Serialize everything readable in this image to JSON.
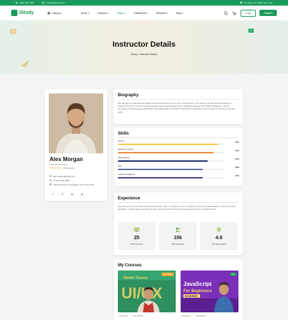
{
  "topbar": {
    "phone": "(000) 456 7890",
    "email": "contact@istudy.com",
    "address": "Brooklyn, NY 11201, New York"
  },
  "header": {
    "brand": "iStudy",
    "category": "Category",
    "nav": [
      {
        "label": "Home",
        "active": false
      },
      {
        "label": "Courses",
        "active": false
      },
      {
        "label": "Pages",
        "active": true
      },
      {
        "label": "Dashboard",
        "active": false
      },
      {
        "label": "Elements",
        "active": false
      },
      {
        "label": "Blog",
        "active": false
      }
    ],
    "login": "Login",
    "register": "Register"
  },
  "hero": {
    "title": "Instructor Details",
    "crumb_home": "iStudy",
    "crumb_sep": "›",
    "crumb_current": "Instructor Details"
  },
  "profile": {
    "name": "Alex Morgan",
    "title": "Data Science Expert",
    "stars": "★★★★★",
    "reviews": "(24 Reviews)",
    "email": "alex.morgan@istudy.com",
    "phone": "+1 (123) 456 7890",
    "address": "1123 Learning St, Knowledge City, KC 56 7153",
    "socials": [
      "f",
      "𝕏",
      "in",
      "◎"
    ]
  },
  "biography": {
    "title": "Biography",
    "text": "Alex Morgan is a Data Science Expert and an instructor with over 8 years of experience in the industry. He has trained thousands of students through his course in turning complex topics such as Data Science, Machine Learning, and Artificial Intelligence, into the education of Learning data professional in accessible topics in education of all levels in education of anyone keen to learn for to the tech world."
  },
  "skills": {
    "title": "Skills",
    "items": [
      {
        "name": "Python",
        "pct": "95%",
        "value": 95,
        "color": "#f5c84a"
      },
      {
        "name": "Machine Learning",
        "pct": "90%",
        "value": 90,
        "color": "#f08a3a"
      },
      {
        "name": "Data Analysis",
        "pct": "85%",
        "value": 85,
        "color": "#1b2a6b"
      },
      {
        "name": "SQL",
        "pct": "80%",
        "value": 80,
        "color": "#5b6f9a"
      },
      {
        "name": "Artificial Intelligence",
        "pct": "80%",
        "value": 80,
        "color": "#4a3f8a"
      }
    ]
  },
  "experience": {
    "title": "Experience",
    "text": "Alex has been a Senior Data Scientist at TechCorp, where he worked on various predictive models and data analytics, machine learning algorithms, working data processing. He was previously with the faculty and has spearhead many initiatives of ML.",
    "stats": [
      {
        "value": "25",
        "label": "Total Courses",
        "icon": "book-icon"
      },
      {
        "value": "15k",
        "label": "Total Students",
        "icon": "students-icon"
      },
      {
        "value": "4.8",
        "label": "Average Rating",
        "icon": "star-icon"
      }
    ]
  },
  "courses": {
    "title": "My Courses",
    "items": [
      {
        "badge": "Best Seller",
        "badge_color": "#f5a623",
        "banner": "Starter Course",
        "big": "UI/UX",
        "sub": "",
        "meta": [
          "20 Lessons",
          "120 Students"
        ]
      },
      {
        "badge": "New",
        "badge_color": "#1a9a5a",
        "banner": "",
        "big": "JavaScript",
        "sub": "For Beginners",
        "tag": "BEGINNER",
        "meta": [
          "15 Lessons",
          "100 Students"
        ]
      }
    ]
  }
}
